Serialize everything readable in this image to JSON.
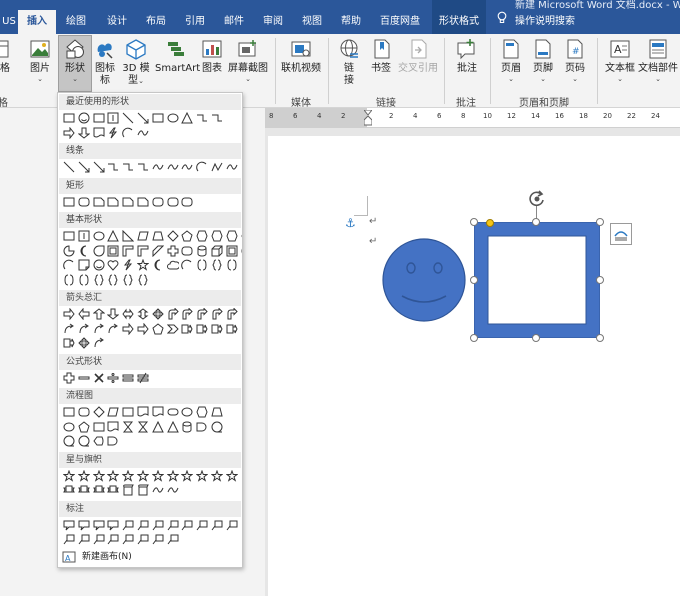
{
  "titlebar": {
    "doc_title": "新建 Microsoft Word 文档.docx - Wo"
  },
  "tabs": [
    {
      "label": "US",
      "state": "normal"
    },
    {
      "label": "插入",
      "state": "active"
    },
    {
      "label": "绘图",
      "state": "normal"
    },
    {
      "label": "设计",
      "state": "normal"
    },
    {
      "label": "布局",
      "state": "normal"
    },
    {
      "label": "引用",
      "state": "normal"
    },
    {
      "label": "邮件",
      "state": "normal"
    },
    {
      "label": "审阅",
      "state": "normal"
    },
    {
      "label": "视图",
      "state": "normal"
    },
    {
      "label": "帮助",
      "state": "normal"
    },
    {
      "label": "百度网盘",
      "state": "normal"
    },
    {
      "label": "形状格式",
      "state": "context"
    }
  ],
  "tellme": {
    "icon": "lightbulb-icon",
    "label": "操作说明搜索"
  },
  "ribbon": {
    "buttons": [
      {
        "label": "格",
        "icon": "table-icon"
      },
      {
        "label": "图片",
        "icon": "picture-icon",
        "caret": "⌄"
      },
      {
        "label": "形状",
        "icon": "shapes-icon",
        "caret": "⌄",
        "pressed": true
      },
      {
        "label": "图标",
        "line2": "标",
        "icon": "icons-icon"
      },
      {
        "label": "3D 模",
        "line2": "型",
        "icon": "3d-model-icon",
        "caret": "⌄"
      },
      {
        "label": "SmartArt",
        "icon": "smartart-icon"
      },
      {
        "label": "图表",
        "icon": "chart-icon"
      },
      {
        "label": "屏幕截图",
        "icon": "screenshot-icon",
        "caret": "⌄"
      },
      {
        "label": "联机视频",
        "icon": "online-video-icon"
      },
      {
        "label": "链",
        "line2": "接",
        "icon": "link-icon"
      },
      {
        "label": "书签",
        "icon": "bookmark-icon"
      },
      {
        "label": "交叉引用",
        "icon": "cross-reference-icon",
        "disabled": true
      },
      {
        "label": "批注",
        "icon": "comment-icon"
      },
      {
        "label": "页眉",
        "icon": "header-icon",
        "caret": "⌄"
      },
      {
        "label": "页脚",
        "icon": "footer-icon",
        "caret": "⌄"
      },
      {
        "label": "页码",
        "icon": "page-number-icon",
        "caret": "⌄"
      },
      {
        "label": "文本框",
        "icon": "textbox-icon",
        "caret": "⌄"
      },
      {
        "label": "文档部件",
        "icon": "quick-parts-icon",
        "caret": "⌄"
      }
    ],
    "groups": [
      "格",
      "媒体",
      "链接",
      "批注",
      "页眉和页脚"
    ]
  },
  "ruler": {
    "ticks": [
      "8",
      "6",
      "4",
      "2",
      "2",
      "4",
      "6",
      "8",
      "10",
      "12",
      "14",
      "16",
      "18",
      "20",
      "22",
      "24"
    ]
  },
  "shapes_panel": {
    "sections": [
      {
        "title": "最近使用的形状",
        "rows": [
          [
            "rect",
            "smiley",
            "textbox",
            "vtextbox",
            "line",
            "arrow",
            "rect",
            "oval",
            "tri",
            "elbow",
            "elbow"
          ],
          [
            "arrow-r",
            "arrow-d",
            "flowdoc",
            "lightning",
            "arc",
            "wave"
          ]
        ]
      },
      {
        "title": "线条",
        "rows": [
          [
            "line",
            "arrow",
            "dblarrow",
            "elbow",
            "elbow",
            "elbow",
            "curve",
            "curve",
            "curve",
            "arc",
            "freeform",
            "scribble"
          ]
        ]
      },
      {
        "title": "矩形",
        "rows": [
          [
            "rect",
            "rounded",
            "snip",
            "snip",
            "snip",
            "snip",
            "rounded",
            "rounded",
            "rounded"
          ]
        ]
      },
      {
        "title": "基本形状",
        "rows": [
          [
            "textbox",
            "vtextbox",
            "oval",
            "tri",
            "rtri",
            "para",
            "trap",
            "diamond",
            "pent",
            "hex",
            "hept",
            "oct",
            "dec",
            "dodec"
          ],
          [
            "pie",
            "chord",
            "tear",
            "frame",
            "halfframe",
            "lshape",
            "diagstripe",
            "cross",
            "plaque",
            "can",
            "cube",
            "bevel",
            "donut",
            "nosymbol"
          ],
          [
            "blockarc",
            "fold",
            "smiley",
            "heart",
            "lightning",
            "sun",
            "moon",
            "cloud",
            "arc",
            "bracket",
            "brace",
            "bracket2",
            "brace2",
            "brace3"
          ],
          [
            "bracket",
            "bracket",
            "brace",
            "brace",
            "brace",
            "brace"
          ]
        ]
      },
      {
        "title": "箭头总汇",
        "rows": [
          [
            "arrow-r",
            "arrow-l",
            "arrow-u",
            "arrow-d",
            "arrow-lr",
            "arrow-ud",
            "quad",
            "lr-up",
            "bent",
            "uturn",
            "leftup",
            "bentup"
          ],
          [
            "curved",
            "curved",
            "curved",
            "curved",
            "stripe",
            "notched",
            "pentagon",
            "chevron",
            "callout-r",
            "callout-d",
            "callout-l",
            "callout-u"
          ],
          [
            "callout-lr",
            "callout-quad",
            "circular"
          ]
        ]
      },
      {
        "title": "公式形状",
        "rows": [
          [
            "plus",
            "minus",
            "mult",
            "div",
            "equal",
            "noteq"
          ]
        ]
      },
      {
        "title": "流程图",
        "rows": [
          [
            "rect",
            "rounded",
            "diamond",
            "para",
            "rect",
            "flowdoc",
            "flowdoc",
            "terminator",
            "oval",
            "hex",
            "trap"
          ],
          [
            "oval",
            "pent",
            "rect",
            "flowdoc",
            "collate",
            "sort",
            "extract",
            "merge",
            "store",
            "delay",
            "seq"
          ],
          [
            "mag",
            "disk",
            "display",
            "delay"
          ]
        ]
      },
      {
        "title": "星与旗帜",
        "rows": [
          [
            "star",
            "star",
            "star",
            "star",
            "star",
            "star",
            "star",
            "star",
            "star",
            "star",
            "star",
            "star"
          ],
          [
            "ribbon",
            "ribbon",
            "ribbon",
            "ribbon",
            "scroll",
            "scroll",
            "wave",
            "dwave"
          ]
        ]
      },
      {
        "title": "标注",
        "rows": [
          [
            "callout",
            "callout",
            "callout",
            "callout",
            "linecallout",
            "linecallout",
            "linecallout",
            "linecallout",
            "linecallout",
            "linecallout",
            "linecallout",
            "linecallout"
          ],
          [
            "linecallout",
            "linecallout",
            "linecallout",
            "linecallout",
            "linecallout",
            "linecallout",
            "linecallout",
            "linecallout"
          ]
        ]
      }
    ],
    "new_canvas": {
      "icon": "canvas-icon",
      "label": "新建画布(N)"
    }
  },
  "document": {
    "paragraph_mark": "↵",
    "anchor": "anchor-icon",
    "smiley_color": "#4472c4",
    "frame_color": "#4472c4",
    "rotate": "rotate-icon",
    "layout_options": "layout-options-icon"
  }
}
